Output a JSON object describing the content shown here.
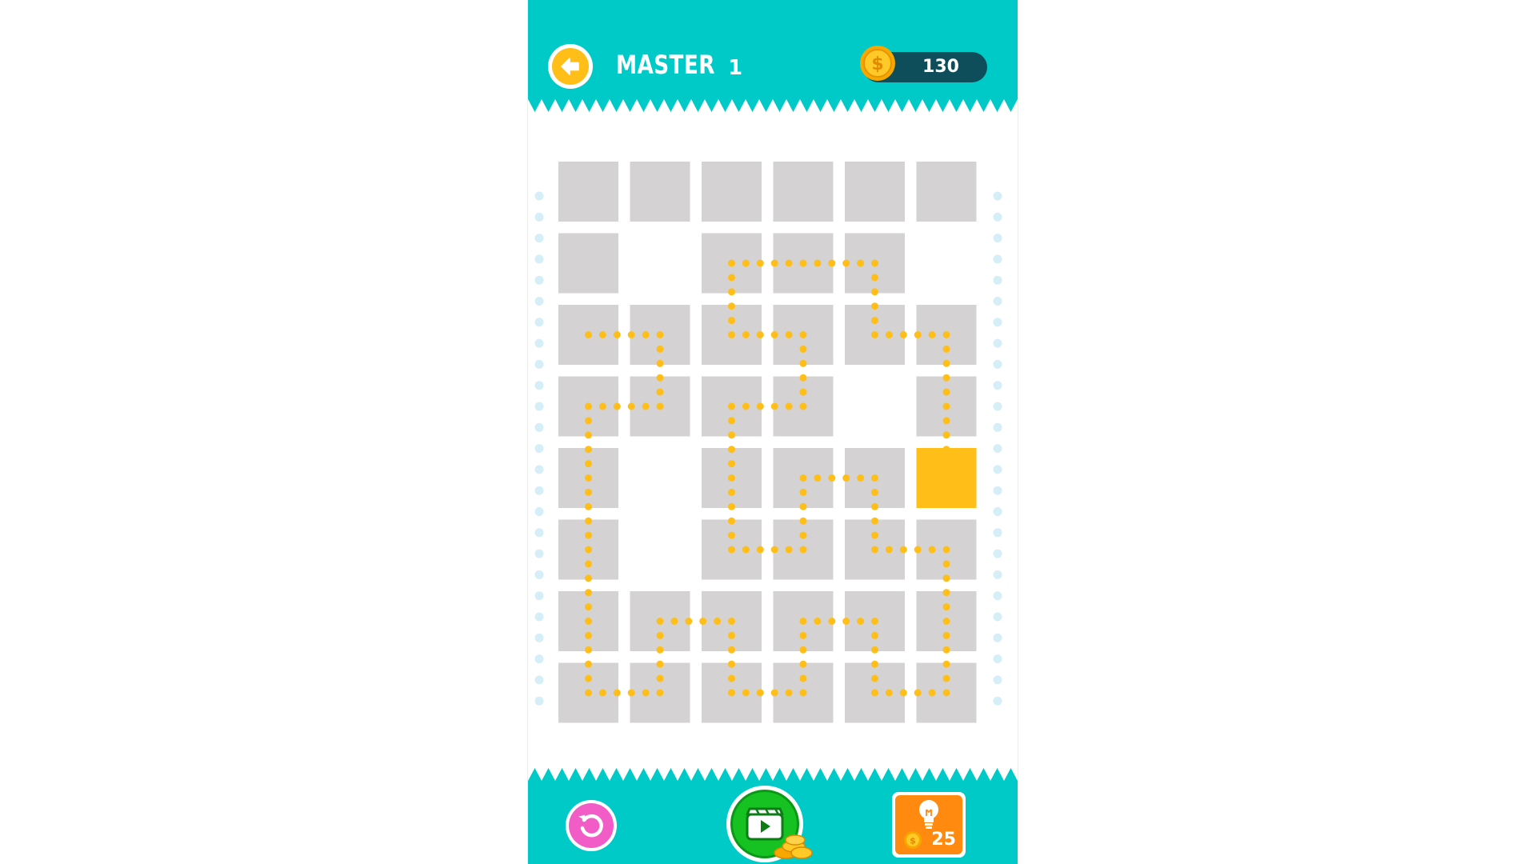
{
  "header": {
    "mode": "MASTER",
    "level": "1",
    "coins": "130"
  },
  "hint": {
    "cost": "25"
  },
  "colors": {
    "teal": "#00cac8",
    "cell_gray": "#d4d2d3",
    "path_dot": "#ffbe18",
    "active_cell": "#ffbe18",
    "coin_pill": "#0d4e5a",
    "restart_pink": "#f25cc6",
    "video_green": "#16c221",
    "hint_orange": "#ff8a0f",
    "side_dot": "#d6eef7"
  },
  "icons": {
    "back": "arrow-left-icon",
    "coin": "dollar-coin-icon",
    "restart": "restart-icon",
    "video": "video-play-icon",
    "hint": "lightbulb-icon"
  },
  "grid": {
    "rows": 8,
    "cols": 6,
    "cells": [
      [
        "g",
        "g",
        "g",
        "g",
        "g",
        "g"
      ],
      [
        "g",
        "e",
        "g",
        "g",
        "g",
        "e"
      ],
      [
        "g",
        "g",
        "g",
        "g",
        "g",
        "g"
      ],
      [
        "g",
        "g",
        "g",
        "g",
        "e",
        "g"
      ],
      [
        "g",
        "e",
        "g",
        "g",
        "g",
        "a"
      ],
      [
        "g",
        "e",
        "g",
        "g",
        "g",
        "g"
      ],
      [
        "g",
        "g",
        "g",
        "g",
        "g",
        "g"
      ],
      [
        "g",
        "g",
        "g",
        "g",
        "g",
        "g"
      ]
    ],
    "path": [
      [
        4,
        5
      ],
      [
        3,
        5
      ],
      [
        2,
        5
      ],
      [
        2,
        4
      ],
      [
        1,
        4
      ],
      [
        1,
        3
      ],
      [
        1,
        2
      ],
      [
        2,
        2
      ],
      [
        2,
        3
      ],
      [
        3,
        3
      ],
      [
        3,
        2
      ],
      [
        4,
        2
      ],
      [
        5,
        2
      ],
      [
        5,
        3
      ],
      [
        4,
        3
      ],
      [
        4,
        4
      ],
      [
        5,
        4
      ],
      [
        5,
        5
      ],
      [
        6,
        5
      ],
      [
        7,
        5
      ],
      [
        7,
        4
      ],
      [
        6,
        4
      ],
      [
        6,
        3
      ],
      [
        7,
        3
      ],
      [
        7,
        2
      ],
      [
        6,
        2
      ],
      [
        6,
        1
      ],
      [
        7,
        1
      ],
      [
        7,
        0
      ],
      [
        6,
        0
      ],
      [
        5,
        0
      ],
      [
        4,
        0
      ],
      [
        3,
        0
      ],
      [
        3,
        1
      ],
      [
        2,
        1
      ],
      [
        2,
        0
      ]
    ]
  }
}
